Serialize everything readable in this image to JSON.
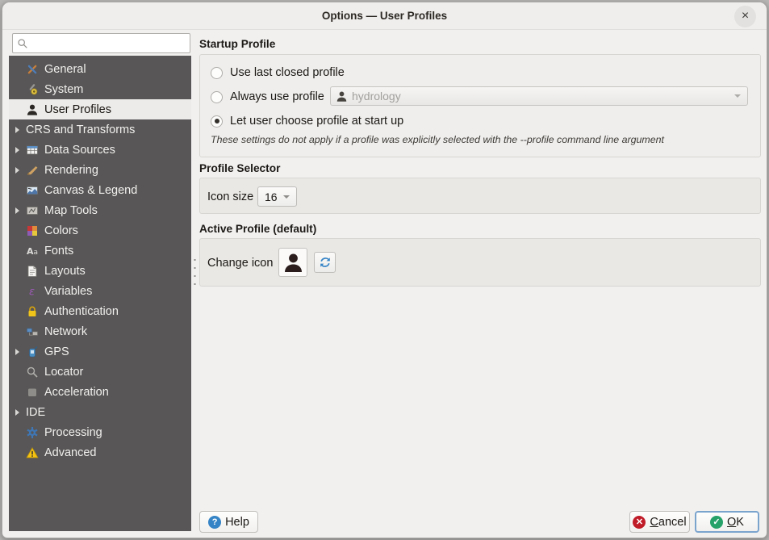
{
  "window": {
    "title": "Options — User Profiles",
    "close_glyph": "×"
  },
  "sidebar": {
    "search": {
      "placeholder": "",
      "value": ""
    },
    "items": [
      {
        "label": "General"
      },
      {
        "label": "System"
      },
      {
        "label": "User Profiles"
      },
      {
        "label": "CRS and Transforms"
      },
      {
        "label": "Data Sources"
      },
      {
        "label": "Rendering"
      },
      {
        "label": "Canvas & Legend"
      },
      {
        "label": "Map Tools"
      },
      {
        "label": "Colors"
      },
      {
        "label": "Fonts"
      },
      {
        "label": "Layouts"
      },
      {
        "label": "Variables"
      },
      {
        "label": "Authentication"
      },
      {
        "label": "Network"
      },
      {
        "label": "GPS"
      },
      {
        "label": "Locator"
      },
      {
        "label": "Acceleration"
      },
      {
        "label": "IDE"
      },
      {
        "label": "Processing"
      },
      {
        "label": "Advanced"
      }
    ],
    "selected_item": "User Profiles"
  },
  "startup": {
    "heading": "Startup Profile",
    "radio_use_last": "Use last closed profile",
    "radio_always": "Always use profile",
    "profile_combo_value": "hydrology",
    "radio_let_user_choose": "Let user choose profile at start up",
    "selected_radio": "Let user choose profile at start up",
    "note": "These settings do not apply if a profile was explicitly selected with the --profile command line argument"
  },
  "profile_selector": {
    "heading": "Profile Selector",
    "icon_size_label": "Icon size",
    "icon_size_value": "16"
  },
  "active_profile": {
    "heading": "Active Profile (default)",
    "change_icon_label": "Change icon"
  },
  "footer": {
    "help_label": "Help",
    "help_glyph": "?",
    "cancel_glyph": "✕",
    "cancel_accel": "C",
    "cancel_rest": "ancel",
    "ok_glyph": "✓",
    "ok_accel": "O",
    "ok_rest": "K"
  },
  "colors": {
    "sidebar_bg": "#585656",
    "selection_bg": "#edebe9",
    "accent_blue": "#3584c6",
    "cancel_red": "#c01c28",
    "ok_green": "#26a269",
    "warning_yellow": "#f0c419"
  }
}
